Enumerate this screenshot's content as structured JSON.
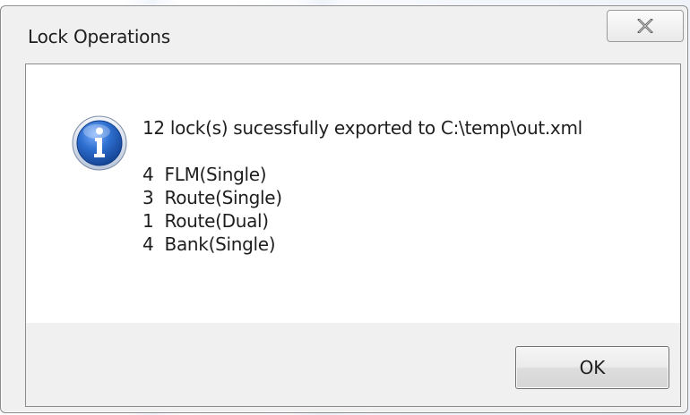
{
  "window": {
    "title": "Lock Operations",
    "close_icon": "close-icon"
  },
  "message": {
    "icon": "info-icon",
    "headline": "12 lock(s) sucessfully exported to C:\\temp\\out.xml",
    "details": [
      "4  FLM(Single)",
      "3  Route(Single)",
      "1  Route(Dual)",
      "4  Bank(Single)"
    ]
  },
  "buttons": {
    "ok_label": "OK"
  },
  "colors": {
    "dialog_background": "#f0f0f0",
    "content_background": "#ffffff",
    "icon_blue": "#1f5fb8"
  }
}
